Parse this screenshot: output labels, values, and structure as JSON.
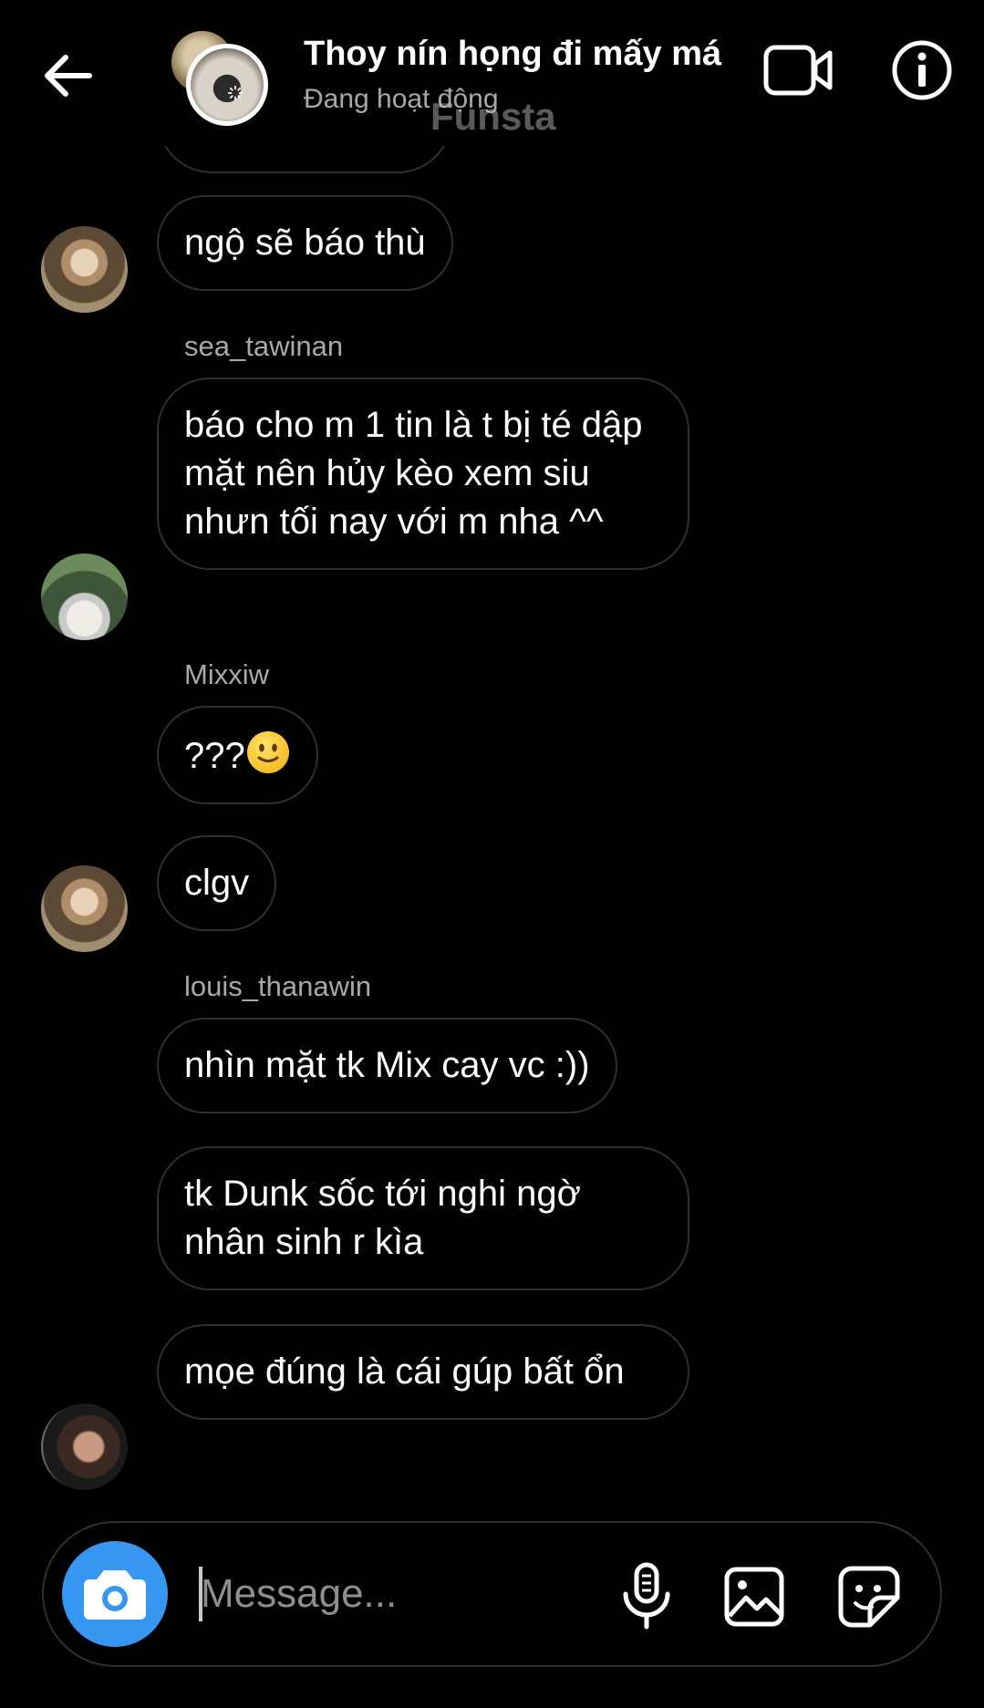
{
  "header": {
    "title": "Thoy nín họng đi mấy má",
    "status": "Đang hoạt động",
    "watermark": "Funsta"
  },
  "messages": [
    {
      "sender": "",
      "text": "ngộ sẽ báo thù"
    },
    {
      "sender": "sea_tawinan",
      "text": "báo cho m 1 tin là t bị té dập mặt nên hủy kèo xem siu nhưn tối nay với m nha ^^"
    },
    {
      "sender": "Mixxiw",
      "text": "???",
      "emoji": "slightly-smiling-face"
    },
    {
      "sender": "",
      "text": "clgv"
    },
    {
      "sender": "louis_thanawin",
      "text": "nhìn mặt tk Mix cay vc :))"
    },
    {
      "sender": "",
      "text": "tk Dunk sốc tới nghi ngờ nhân sinh r kìa"
    },
    {
      "sender": "",
      "text": "mọe đúng là cái gúp bất ổn"
    }
  ],
  "composer": {
    "placeholder": "Message..."
  },
  "colors": {
    "background": "#000000",
    "bubble_border": "#2f2f2f",
    "accent": "#3797f0",
    "secondary_text": "#a8a8a8"
  },
  "icons": [
    "back-arrow-icon",
    "video-call-icon",
    "info-icon",
    "camera-icon",
    "microphone-icon",
    "gallery-icon",
    "sticker-icon"
  ]
}
